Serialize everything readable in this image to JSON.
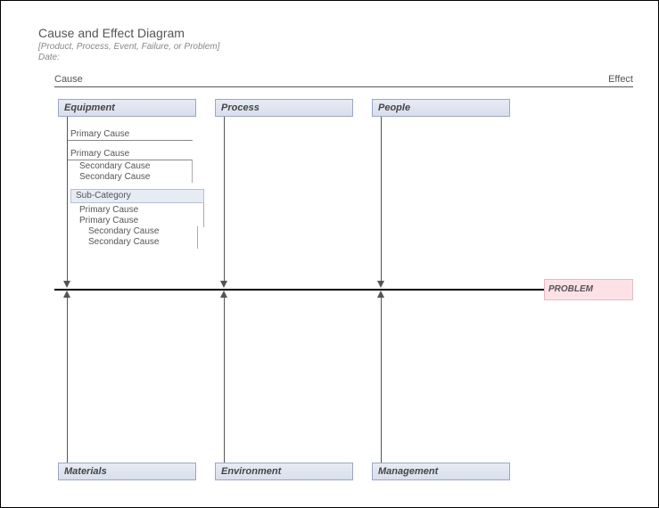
{
  "header": {
    "title": "Cause and Effect Diagram",
    "subtitle": "[Product, Process, Event, Failure, or Problem]",
    "date_label": "Date:"
  },
  "labels": {
    "cause": "Cause",
    "effect": "Effect"
  },
  "categories": {
    "top": [
      "Equipment",
      "Process",
      "People"
    ],
    "bottom": [
      "Materials",
      "Environment",
      "Management"
    ]
  },
  "problem": "PROBLEM",
  "equipment_causes": {
    "primary1": "Primary Cause",
    "primary2": "Primary Cause",
    "secondary1": "Secondary Cause",
    "secondary2": "Secondary Cause",
    "subcat": "Sub-Category",
    "sub_primary1": "Primary Cause",
    "sub_primary2": "Primary Cause",
    "sub_secondary1": "Secondary Cause",
    "sub_secondary2": "Secondary Cause"
  },
  "chart_data": {
    "type": "fishbone",
    "title": "Cause and Effect Diagram",
    "effect": "PROBLEM",
    "top_categories": [
      {
        "name": "Equipment",
        "causes": [
          {
            "label": "Primary Cause",
            "children": []
          },
          {
            "label": "Primary Cause",
            "children": [
              {
                "label": "Secondary Cause"
              },
              {
                "label": "Secondary Cause"
              }
            ]
          },
          {
            "label": "Sub-Category",
            "is_subcategory": true,
            "children": [
              {
                "label": "Primary Cause"
              },
              {
                "label": "Primary Cause",
                "children": [
                  {
                    "label": "Secondary Cause"
                  },
                  {
                    "label": "Secondary Cause"
                  }
                ]
              }
            ]
          }
        ]
      },
      {
        "name": "Process",
        "causes": []
      },
      {
        "name": "People",
        "causes": []
      }
    ],
    "bottom_categories": [
      {
        "name": "Materials",
        "causes": []
      },
      {
        "name": "Environment",
        "causes": []
      },
      {
        "name": "Management",
        "causes": []
      }
    ]
  }
}
